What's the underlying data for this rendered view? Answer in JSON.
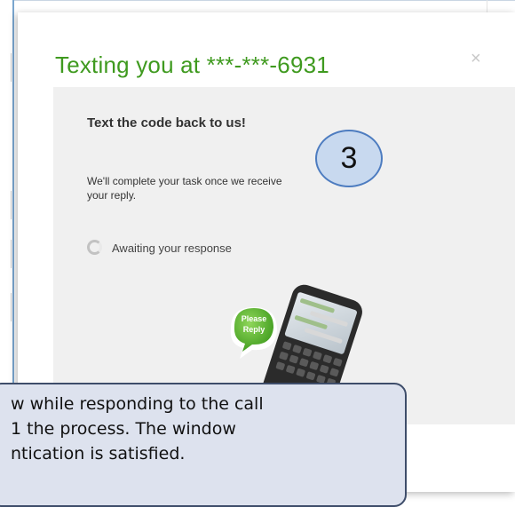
{
  "modal": {
    "title": "Texting you at ***-***-6931",
    "close_glyph": "×"
  },
  "panel": {
    "heading": "Text the code back to us!",
    "body": "We'll complete your task once we receive your reply.",
    "status": "Awaiting your response"
  },
  "illustration": {
    "bubble_text": "Please Reply",
    "icon": "phone-with-speech-bubble"
  },
  "step_badge": {
    "number": "3"
  },
  "callout": {
    "text": "w while responding to the call\n1 the process. The window\nntication is satisfied."
  },
  "colors": {
    "title_green": "#3f9a1f",
    "panel_bg": "#f0f0f0",
    "badge_fill": "#c8d9ef",
    "badge_border": "#4d7cc0",
    "callout_fill": "#dde2ee",
    "callout_border": "#3e4d6a",
    "bubble_green": "#4fb52a"
  }
}
